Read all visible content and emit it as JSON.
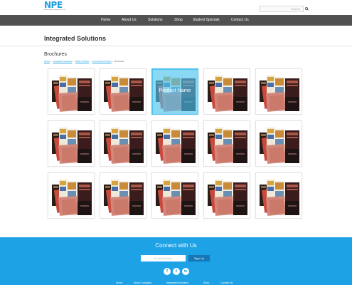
{
  "header": {
    "logo_text": "NPE",
    "logo_subtitle": "New Graphics & Systems Pvt Ltd",
    "search_placeholder": "Search",
    "brand_color": "#1e9fe0"
  },
  "nav": {
    "items": [
      {
        "label": "Home"
      },
      {
        "label": "About Us"
      },
      {
        "label": "Solutions"
      },
      {
        "label": "Shop"
      },
      {
        "label": "Student Specials"
      },
      {
        "label": "Contact Us"
      }
    ],
    "bg_color": "#515151"
  },
  "page": {
    "title": "Integrated Solutions",
    "section_title": "Brochures",
    "breadcrumb": [
      "Home",
      "Integrated Solutions",
      "Offset Printing",
      "Commercial Printing",
      "Brochures"
    ]
  },
  "products": {
    "hover_label": "Product Name",
    "hover_color": "#4dc3f0",
    "count": 15
  },
  "footer": {
    "title": "Connect with Us",
    "email_placeholder": "Email Address",
    "signup_label": "Sign Up",
    "social": [
      {
        "name": "facebook-icon",
        "glyph": "f"
      },
      {
        "name": "twitter-icon",
        "glyph": "t"
      },
      {
        "name": "linkedin-icon",
        "glyph": "in"
      }
    ],
    "links": [
      "Home",
      "About Company",
      "Integrated Solutions",
      "Shop",
      "Contact Us"
    ],
    "bg_color": "#1ea2e6"
  }
}
